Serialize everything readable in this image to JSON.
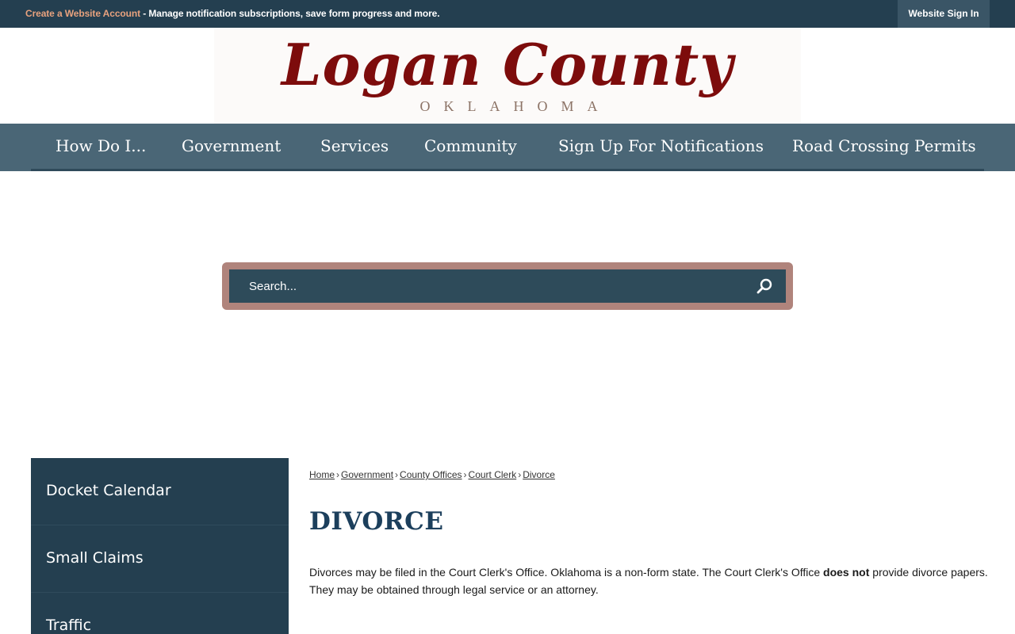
{
  "topbar": {
    "create_account_link": "Create a Website Account",
    "message": " - Manage notification subscriptions, save form progress and more.",
    "sign_in": "Website Sign In"
  },
  "logo": {
    "title": "Logan County",
    "subtitle": "OKLAHOMA"
  },
  "nav": {
    "items": [
      {
        "label": "How Do I..."
      },
      {
        "label": "Government"
      },
      {
        "label": "Services"
      },
      {
        "label": "Community"
      },
      {
        "label": "Sign Up For Notifications"
      },
      {
        "label": "Road Crossing Permits"
      }
    ]
  },
  "search": {
    "placeholder": "Search..."
  },
  "sidebar": {
    "items": [
      {
        "label": "Docket Calendar"
      },
      {
        "label": "Small Claims"
      },
      {
        "label": "Traffic"
      }
    ]
  },
  "breadcrumb": {
    "items": [
      "Home",
      "Government",
      "County Offices",
      "Court Clerk",
      "Divorce"
    ],
    "separator": "›"
  },
  "page": {
    "title": "DIVORCE",
    "text_part1": "Divorces may be filed in the Court Clerk's Office.  Oklahoma is a non-form state. The Court Clerk's Office ",
    "text_bold": "does not",
    "text_part2": " provide divorce papers. They may be obtained through legal service or an attorney."
  },
  "colors": {
    "topbar": "#243f50",
    "nav": "#4a6676",
    "logo": "#7d0c0c",
    "search_frame": "#b0847c",
    "search_box": "#2e4b5a",
    "accent_link": "#e8a27e",
    "title": "#1c3f5c"
  },
  "icons": {
    "search": "search-icon"
  }
}
